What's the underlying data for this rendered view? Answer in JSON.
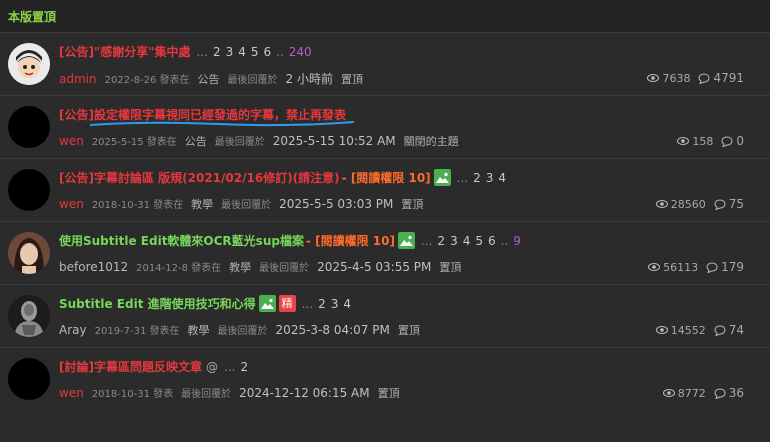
{
  "section_title": "本版置頂",
  "threads": [
    {
      "title": "[公告]\"感謝分享\"集中處",
      "title_color": "red",
      "pages": [
        "...",
        "2",
        "3",
        "4",
        "5",
        "6",
        "..",
        "240"
      ],
      "author": "admin",
      "author_color": "red",
      "posted": "2022-8-26 發表在",
      "forum": "公告",
      "last_reply_label": "最後回覆於",
      "last_reply": "2 小時前",
      "status": "置頂",
      "views": "7638",
      "replies": "4791",
      "avatar": "cartoon-avatar"
    },
    {
      "title": "[公告]設定權限字幕視同已經發過的字幕，禁止再發表",
      "title_color": "red",
      "pages": [],
      "author": "wen",
      "author_color": "red",
      "posted": "2025-5-15 發表在",
      "forum": "公告",
      "last_reply_label": "最後回覆於",
      "last_reply": "2025-5-15 10:52 AM",
      "status": "關閉的主題",
      "views": "158",
      "replies": "0",
      "avatar": "black-avatar"
    },
    {
      "title": "[公告]字幕討論區 版規(2021/02/16修訂)(請注意)",
      "title_color": "red",
      "permission": "- [閱讀權限 10]",
      "pages": [
        "...",
        "2",
        "3",
        "4"
      ],
      "author": "wen",
      "author_color": "red",
      "posted": "2018-10-31 發表在",
      "forum": "教學",
      "last_reply_label": "最後回覆於",
      "last_reply": "2025-5-5 03:03 PM",
      "status": "置頂",
      "views": "28560",
      "replies": "75",
      "avatar": "black-avatar"
    },
    {
      "title": "使用Subtitle Edit軟體來OCR藍光sup檔案",
      "title_color": "green",
      "permission": "- [閱讀權限 10]",
      "pages": [
        "...",
        "2",
        "3",
        "4",
        "5",
        "6",
        "..",
        "9"
      ],
      "author": "before1012",
      "author_color": "gray",
      "posted": "2014-12-8 發表在",
      "forum": "教學",
      "last_reply_label": "最後回覆於",
      "last_reply": "2025-4-5 03:55 PM",
      "status": "置頂",
      "views": "56113",
      "replies": "179",
      "avatar": "photo-avatar-woman"
    },
    {
      "title": "Subtitle Edit 進階使用技巧和心得",
      "title_color": "green",
      "jing": "精",
      "pages": [
        "...",
        "2",
        "3",
        "4"
      ],
      "author": "Aray",
      "author_color": "gray",
      "posted": "2019-7-31 發表在",
      "forum": "教學",
      "last_reply_label": "最後回覆於",
      "last_reply": "2025-3-8 04:07 PM",
      "status": "置頂",
      "views": "14552",
      "replies": "74",
      "avatar": "photo-avatar-statue"
    },
    {
      "title": "[討論]字幕區問題反映文章",
      "title_color": "red",
      "at_sign": "@",
      "pages": [
        "...",
        "2"
      ],
      "author": "wen",
      "author_color": "red",
      "posted": "2018-10-31 發表",
      "forum": "",
      "last_reply_label": "最後回覆於",
      "last_reply": "2024-12-12 06:15 AM",
      "status": "置頂",
      "views": "8772",
      "replies": "36",
      "avatar": "black-avatar"
    }
  ]
}
